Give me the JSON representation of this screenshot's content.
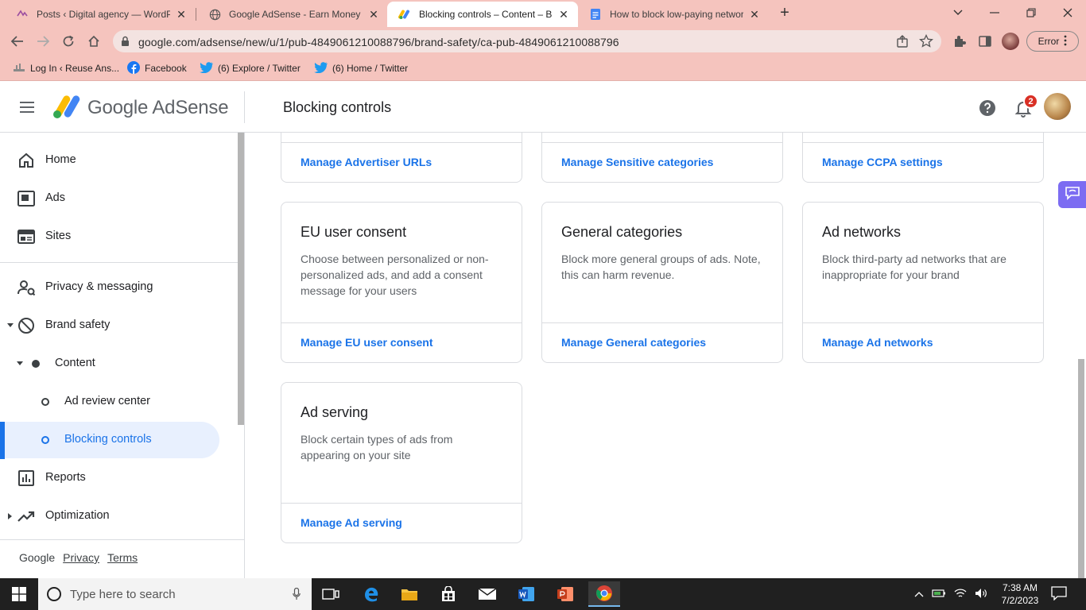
{
  "browser": {
    "tabs": [
      {
        "title": "Posts ‹ Digital agency — WordPr",
        "favicon": "wordpress-icon",
        "active": false
      },
      {
        "title": "Google AdSense - Earn Money Fr",
        "favicon": "globe-icon",
        "active": false
      },
      {
        "title": "Blocking controls – Content – Bra",
        "favicon": "adsense-icon",
        "active": true
      },
      {
        "title": "How to block low-paying networ",
        "favicon": "docs-icon",
        "active": false
      }
    ],
    "url": "google.com/adsense/new/u/1/pub-4849061210088796/brand-safety/ca-pub-4849061210088796",
    "error_chip": "Error",
    "bookmarks": [
      {
        "label": "Log In ‹ Reuse Ans...",
        "icon": "reuse-icon"
      },
      {
        "label": "Facebook",
        "icon": "facebook-icon"
      },
      {
        "label": "(6) Explore / Twitter",
        "icon": "twitter-icon"
      },
      {
        "label": "(6) Home / Twitter",
        "icon": "twitter-icon"
      }
    ],
    "tab_color": "#f5c4be"
  },
  "header": {
    "brand_google": "Google",
    "brand_product": "AdSense",
    "page_title": "Blocking controls",
    "notification_count": "2"
  },
  "sidebar": {
    "items": [
      {
        "label": "Home",
        "icon": "home-icon"
      },
      {
        "label": "Ads",
        "icon": "ads-icon"
      },
      {
        "label": "Sites",
        "icon": "sites-icon"
      },
      {
        "label": "Privacy & messaging",
        "icon": "privacy-icon"
      },
      {
        "label": "Brand safety",
        "icon": "block-icon"
      },
      {
        "label": "Content",
        "icon": "dot-icon"
      },
      {
        "label": "Ad review center",
        "icon": "circle-icon"
      },
      {
        "label": "Blocking controls",
        "icon": "circle-icon",
        "active": true
      },
      {
        "label": "Reports",
        "icon": "reports-icon"
      },
      {
        "label": "Optimization",
        "icon": "optimization-icon"
      }
    ],
    "footer": {
      "google": "Google",
      "privacy": "Privacy",
      "terms": "Terms"
    }
  },
  "cards": [
    {
      "title": "",
      "description": "",
      "link": "Manage Advertiser URLs"
    },
    {
      "title": "",
      "description": "",
      "link": "Manage Sensitive categories"
    },
    {
      "title": "",
      "description": "",
      "link": "Manage CCPA settings"
    },
    {
      "title": "EU user consent",
      "description": "Choose between personalized or non-personalized ads, and add a consent message for your users",
      "link": "Manage EU user consent"
    },
    {
      "title": "General categories",
      "description": "Block more general groups of ads. Note, this can harm revenue.",
      "link": "Manage General categories"
    },
    {
      "title": "Ad networks",
      "description": "Block third-party ad networks that are inappropriate for your brand",
      "link": "Manage Ad networks"
    },
    {
      "title": "Ad serving",
      "description": "Block certain types of ads from appearing on your site",
      "link": "Manage Ad serving"
    }
  ],
  "taskbar": {
    "search_placeholder": "Type here to search",
    "time": "7:38 AM",
    "date": "7/2/2023"
  },
  "colors": {
    "link": "#1a73e8",
    "active_bg": "#e8f0fe",
    "badge": "#d93025"
  }
}
